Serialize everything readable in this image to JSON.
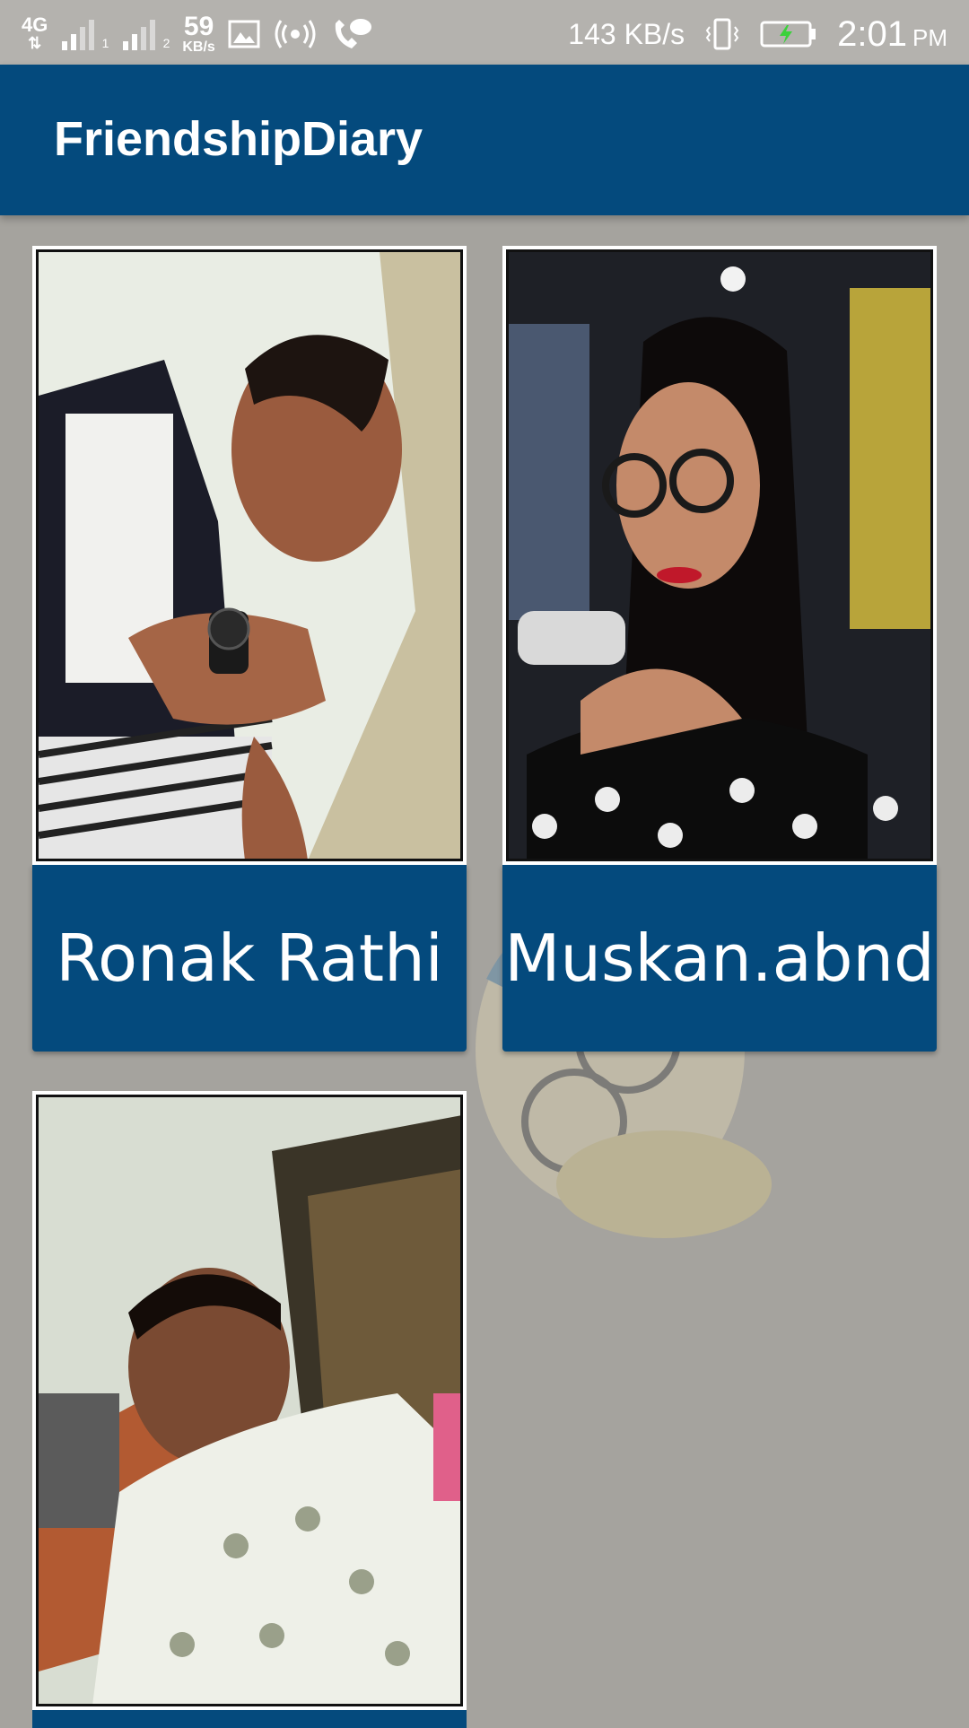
{
  "status_bar": {
    "network_type": "4G",
    "sim1_label": "1",
    "sim2_label": "2",
    "speed_small_value": "59",
    "speed_small_unit": "KB/s",
    "speed_text": "143 KB/s",
    "time": "2:01",
    "ampm": "PM"
  },
  "app_bar": {
    "title": "FriendshipDiary"
  },
  "friends": [
    {
      "name": "Ronak Rathi"
    },
    {
      "name": "Muskan.abnd"
    },
    {
      "name": ""
    }
  ],
  "colors": {
    "primary": "#044a7d",
    "status_bar": "#b4b2ae",
    "background": "#a5a39e"
  }
}
